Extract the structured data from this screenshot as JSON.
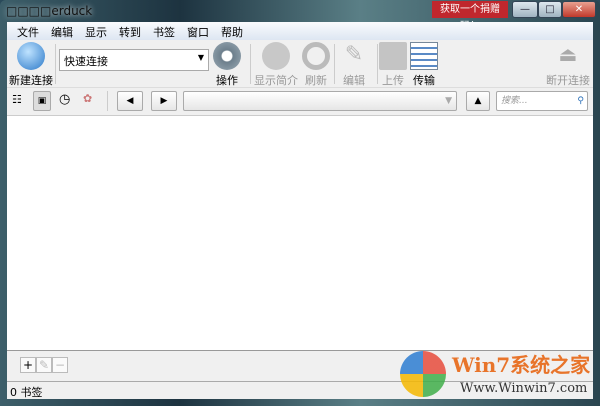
{
  "window": {
    "title": "□□□□erduck",
    "promo": "获取一个捐赠码！",
    "minimize": "—",
    "maximize": "□",
    "close": "✕"
  },
  "menu": [
    "文件",
    "编辑",
    "显示",
    "转到",
    "书签",
    "窗口",
    "帮助"
  ],
  "toolbar": {
    "new_connection": "新建连接",
    "quick_connect": "快速连接",
    "action": "操作",
    "info": "显示简介",
    "refresh": "刷新",
    "edit": "编辑",
    "upload": "上传",
    "transfers": "传输",
    "disconnect": "断开连接"
  },
  "nav": {
    "search_placeholder": "搜索...",
    "back": "◀",
    "forward": "▶",
    "up": "▲"
  },
  "bottom": {
    "add": "+",
    "edit": "✎",
    "remove": "−"
  },
  "status": "0 书签",
  "watermark": {
    "brand": "Win7系统之家",
    "url": "Www.Winwin7.com"
  }
}
